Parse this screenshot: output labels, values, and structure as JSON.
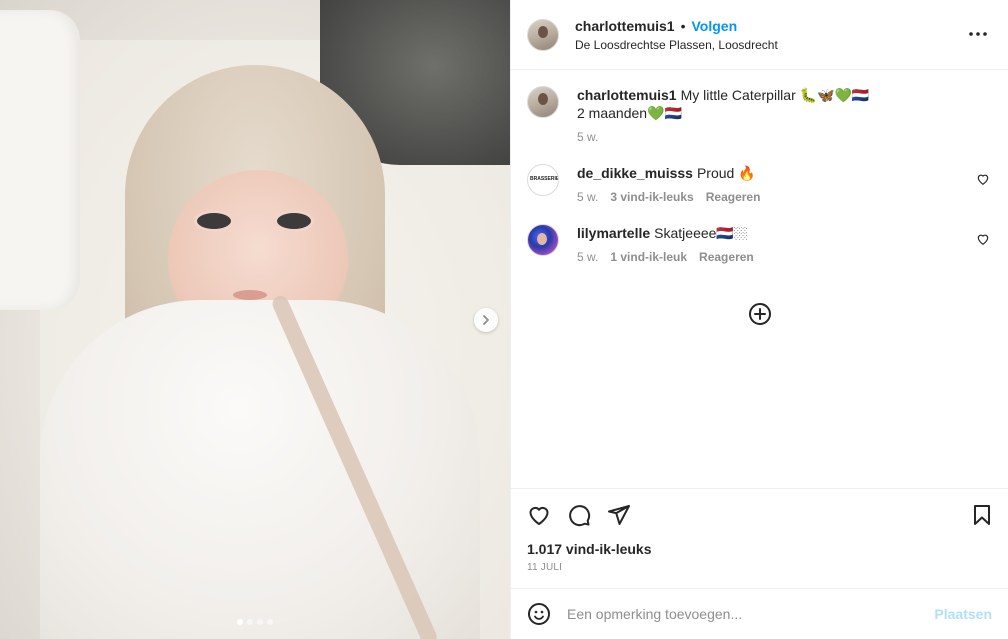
{
  "post": {
    "username": "charlottemuis1",
    "follow_label": "Volgen",
    "bullet": "•",
    "location": "De Loosdrechtse Plassen, Loosdrecht"
  },
  "caption": {
    "username": "charlottemuis1",
    "text": "My little Caterpillar 🐛🦋💚🇳🇱",
    "text_line2": "2 maanden💚🇳🇱",
    "time": "5 w."
  },
  "comments": [
    {
      "username": "de_dikke_muisss",
      "text": "Proud 🔥",
      "time": "5 w.",
      "likes": "3 vind-ik-leuks",
      "reply_label": "Reageren"
    },
    {
      "username": "lilymartelle",
      "text": "Skatjeeee🇳🇱🏼",
      "time": "5 w.",
      "likes": "1 vind-ik-leuk",
      "reply_label": "Reageren"
    }
  ],
  "stats": {
    "likes": "1.017 vind-ik-leuks",
    "date": "11 JULI"
  },
  "add_comment": {
    "placeholder": "Een opmerking toevoegen...",
    "post_label": "Plaatsen"
  },
  "carousel": {
    "count": 4,
    "active_index": 0
  },
  "colors": {
    "accent": "#0095f6",
    "post_disabled": "#b2dffc",
    "muted": "#8e8e8e"
  },
  "icons": [
    "more-icon",
    "heart-icon",
    "comment-icon",
    "share-icon",
    "bookmark-icon",
    "emoji-icon",
    "add-circle-icon",
    "chevron-right-icon"
  ]
}
